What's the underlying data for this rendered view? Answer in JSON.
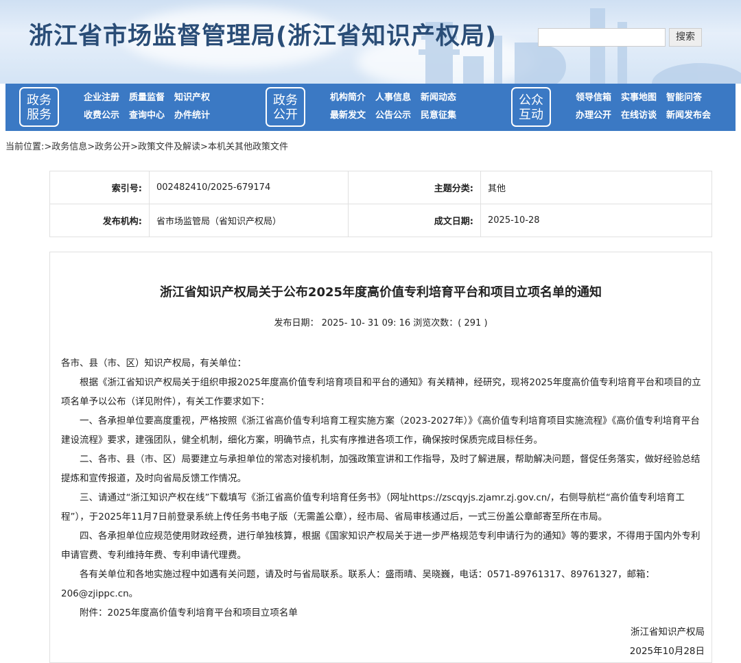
{
  "header": {
    "title": "浙江省市场监督管理局(浙江省知识产权局)",
    "search_placeholder": "",
    "search_button": "搜索"
  },
  "nav": [
    {
      "badge": [
        "政务",
        "服务"
      ],
      "links": [
        "企业注册",
        "质量监督",
        "知识产权",
        "收费公示",
        "查询中心",
        "办件统计"
      ]
    },
    {
      "badge": [
        "政务",
        "公开"
      ],
      "links": [
        "机构简介",
        "人事信息",
        "新闻动态",
        "最新发文",
        "公告公示",
        "民意征集"
      ]
    },
    {
      "badge": [
        "公众",
        "互动"
      ],
      "links": [
        "领导信箱",
        "实事地图",
        "智能问答",
        "办理公开",
        "在线访谈",
        "新闻发布会"
      ]
    }
  ],
  "breadcrumb": "当前位置:>政务信息>政务公开>政策文件及解读>本机关其他政策文件",
  "info": {
    "index_label": "索引号:",
    "index_value": "002482410/2025-679174",
    "category_label": "主题分类:",
    "category_value": "其他",
    "issuer_label": "发布机构:",
    "issuer_value": "省市场监管局（省知识产权局）",
    "date_label": "成文日期:",
    "date_value": "2025-10-28"
  },
  "article": {
    "title": "浙江省知识产权局关于公布2025年度高价值专利培育平台和项目立项名单的通知",
    "meta": "发布日期： 2025- 10- 31 09: 16 浏览次数：( 291 )",
    "salutation": "各市、县（市、区）知识产权局，有关单位：",
    "paragraphs": [
      "根据《浙江省知识产权局关于组织申报2025年度高价值专利培育项目和平台的通知》有关精神，经研究，现将2025年度高价值专利培育平台和项目的立项名单予以公布（详见附件），有关工作要求如下：",
      "一、各承担单位要高度重视，严格按照《浙江省高价值专利培育工程实施方案（2023-2027年）》《高价值专利培育项目实施流程》《高价值专利培育平台建设流程》要求，建强团队，健全机制，细化方案，明确节点，扎实有序推进各项工作，确保按时保质完成目标任务。",
      "二、各市、县（市、区）局要建立与承担单位的常态对接机制，加强政策宣讲和工作指导，及时了解进展，帮助解决问题，督促任务落实，做好经验总结提炼和宣传报道，及时向省局反馈工作情况。",
      "三、请通过“浙江知识产权在线”下载填写《浙江省高价值专利培育任务书》（网址https://zscqyjs.zjamr.zj.gov.cn/，右侧导航栏“高价值专利培育工程”），于2025年11月7日前登录系统上传任务书电子版（无需盖公章），经市局、省局审核通过后，一式三份盖公章邮寄至所在市局。",
      "四、各承担单位应规范使用财政经费，进行单独核算，根据《国家知识产权局关于进一步严格规范专利申请行为的通知》等的要求，不得用于国内外专利申请官费、专利维持年费、专利申请代理费。",
      "各有关单位和各地实施过程中如遇有关问题，请及时与省局联系。联系人：盛雨晴、吴晓巍，电话：0571-89761317、89761327，邮箱：206@zjippc.cn。",
      "附件：2025年度高价值专利培育平台和项目立项名单"
    ],
    "signature": "浙江省知识产权局",
    "sign_date": "2025年10月28日"
  }
}
